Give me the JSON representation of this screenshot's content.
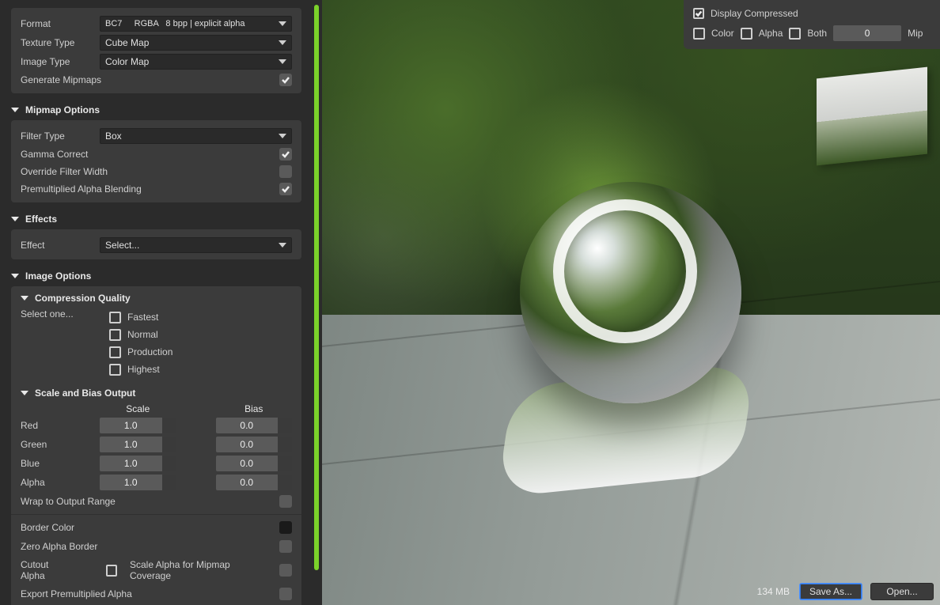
{
  "top": {
    "format_label": "Format",
    "format_value": "BC7     RGBA   8 bpp | explicit alpha",
    "texture_type_label": "Texture Type",
    "texture_type_value": "Cube Map",
    "image_type_label": "Image Type",
    "image_type_value": "Color Map",
    "generate_mipmaps_label": "Generate Mipmaps",
    "generate_mipmaps_checked": true
  },
  "mipmap": {
    "section": "Mipmap Options",
    "filter_type_label": "Filter Type",
    "filter_type_value": "Box",
    "gamma_correct_label": "Gamma Correct",
    "gamma_correct_checked": true,
    "override_filter_label": "Override Filter Width",
    "override_filter_checked": false,
    "premult_label": "Premultiplied Alpha Blending",
    "premult_checked": true
  },
  "effects": {
    "section": "Effects",
    "effect_label": "Effect",
    "effect_value": "Select..."
  },
  "image_options": {
    "section": "Image Options",
    "compression_section": "Compression Quality",
    "select_one": "Select one...",
    "options": [
      "Fastest",
      "Normal",
      "Production",
      "Highest"
    ],
    "scale_bias_section": "Scale and Bias Output",
    "scale_header": "Scale",
    "bias_header": "Bias",
    "channels": [
      {
        "name": "Red",
        "scale": "1.0",
        "bias": "0.0"
      },
      {
        "name": "Green",
        "scale": "1.0",
        "bias": "0.0"
      },
      {
        "name": "Blue",
        "scale": "1.0",
        "bias": "0.0"
      },
      {
        "name": "Alpha",
        "scale": "1.0",
        "bias": "0.0"
      }
    ],
    "wrap_label": "Wrap to Output Range",
    "wrap_checked": false,
    "border_color_label": "Border Color",
    "zero_alpha_border_label": "Zero Alpha Border",
    "zero_alpha_border_checked": false,
    "cutout_alpha_label": "Cutout Alpha",
    "cutout_alpha_checked": false,
    "scale_alpha_cov_label": "Scale Alpha for Mipmap Coverage",
    "scale_alpha_cov_checked": false,
    "export_premult_label": "Export Premultiplied Alpha",
    "export_premult_checked": false
  },
  "hud": {
    "display_compressed_label": "Display Compressed",
    "display_compressed_checked": true,
    "color_label": "Color",
    "alpha_label": "Alpha",
    "both_label": "Both",
    "mip_value": "0",
    "mip_label": "Mip"
  },
  "footer": {
    "size": "134 MB",
    "save_as": "Save As...",
    "open": "Open..."
  }
}
